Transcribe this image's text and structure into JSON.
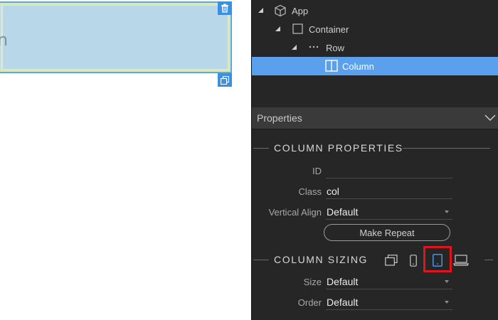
{
  "canvas": {
    "column_text": "n"
  },
  "tree": {
    "items": [
      {
        "label": "App",
        "icon": "cube-icon"
      },
      {
        "label": "Container",
        "icon": "square-icon"
      },
      {
        "label": "Row",
        "icon": "ellipsis-icon"
      },
      {
        "label": "Column",
        "icon": "column-icon"
      }
    ]
  },
  "properties": {
    "header": "Properties",
    "column_properties": {
      "title": "COLUMN PROPERTIES",
      "id_label": "ID",
      "id_value": "",
      "class_label": "Class",
      "class_value": "col",
      "valign_label": "Vertical Align",
      "valign_value": "Default",
      "make_repeat_label": "Make Repeat"
    },
    "column_sizing": {
      "title": "COLUMN SIZING",
      "devices": [
        "all-devices-icon",
        "phone-icon",
        "tablet-icon",
        "laptop-icon"
      ],
      "active_device": "tablet-icon",
      "size_label": "Size",
      "size_value": "Default",
      "order_label": "Order",
      "order_value": "Default"
    }
  },
  "colors": {
    "panel_bg": "#262626",
    "selection": "#5aa0ec",
    "accent_blue": "#3d8fe0",
    "highlight_red": "#e0141e"
  }
}
